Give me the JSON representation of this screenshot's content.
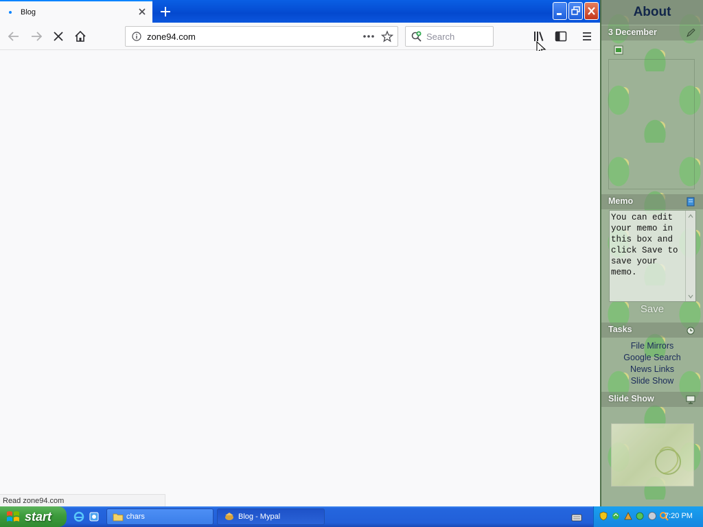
{
  "browser": {
    "tab_title": "Blog",
    "url": "zone94.com",
    "search_placeholder": "Search",
    "status": "Read zone94.com"
  },
  "sidebar": {
    "title": "About",
    "calendar_date": "3 December",
    "memo_label": "Memo",
    "memo_text": "You can edit your memo in this box and click Save to save your memo.",
    "save_label": "Save",
    "tasks_label": "Tasks",
    "tasks": [
      "File Mirrors",
      "Google Search",
      "News Links",
      "Slide Show"
    ],
    "slideshow_label": "Slide Show"
  },
  "taskbar": {
    "start_label": "start",
    "folder_label": "chars",
    "window_label": "Blog - Mypal",
    "clock": "7:20 PM"
  },
  "icons": {
    "tab_favicon": "dot-icon",
    "close": "close-icon",
    "new_tab": "plus-icon",
    "back": "back-arrow-icon",
    "forward": "forward-arrow-icon",
    "stop": "stop-icon",
    "home": "home-icon",
    "site_info": "info-icon",
    "page_actions": "more-icon",
    "bookmark": "star-icon",
    "library": "library-icon",
    "sidebar": "sidebar-icon",
    "menu": "hamburger-icon"
  },
  "colors": {
    "accent": "#0a84ff",
    "titlebar": "#0449cf",
    "close_red": "#c3361a",
    "start_green": "#3c9b3c",
    "sidebar_title": "#12264a"
  }
}
